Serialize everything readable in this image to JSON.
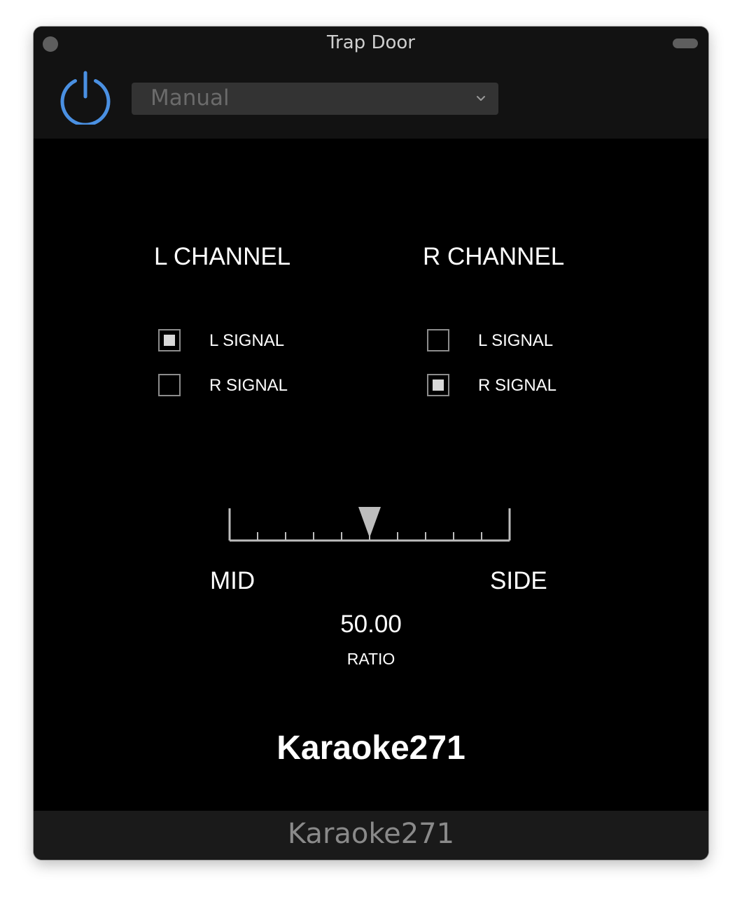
{
  "window": {
    "title": "Trap Door"
  },
  "toolbar": {
    "power_icon": "power-icon",
    "power_color": "#4a90e2",
    "preset": {
      "value": "Manual",
      "icon": "chevron-down-icon"
    }
  },
  "left_channel": {
    "title": "L CHANNEL",
    "options": [
      {
        "label": "L SIGNAL",
        "checked": true
      },
      {
        "label": "R SIGNAL",
        "checked": false
      }
    ]
  },
  "right_channel": {
    "title": "R CHANNEL",
    "options": [
      {
        "label": "L SIGNAL",
        "checked": false
      },
      {
        "label": "R SIGNAL",
        "checked": true
      }
    ]
  },
  "ratio": {
    "min_label": "MID",
    "max_label": "SIDE",
    "value": "50.00",
    "value_fraction": 0.5,
    "label": "RATIO"
  },
  "brand": {
    "name": "Karaoke271"
  },
  "footer": {
    "text": "Karaoke271"
  }
}
